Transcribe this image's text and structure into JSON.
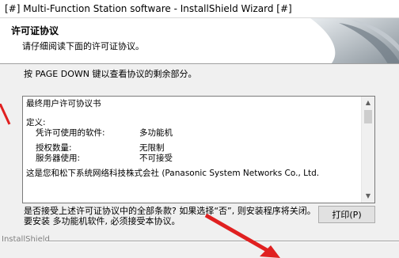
{
  "window": {
    "title": "[#] Multi-Function Station software - InstallShield Wizard [#]"
  },
  "header": {
    "title": "许可证协议",
    "subtitle": "请仔细阅读下面的许可证协议。"
  },
  "instruction": "按 PAGE DOWN 键以查看协议的剩余部分。",
  "license": {
    "heading": "最终用户许可协议书",
    "definition_label": "定义:",
    "rows": [
      {
        "key": "凭许可使用的软件:",
        "value": "多功能机"
      },
      {
        "key": "授权数量:",
        "value": "无限制"
      },
      {
        "key": "服务器使用:",
        "value": "不可接受"
      }
    ],
    "last_line": "这是您和松下系统网络科技株式会社 (Panasonic System Networks Co., Ltd."
  },
  "scrollbar": {
    "up_icon": "▲",
    "down_icon": "▼",
    "position": 0.0
  },
  "question": "是否接受上述许可证协议中的全部条款? 如果选择“否”, 则安装程序将关闭。要安装 多功能机软件, 必须接受本协议。",
  "buttons": {
    "print": "打印(P)"
  },
  "footer": {
    "brand": "InstallShield"
  },
  "colors": {
    "annotation_arrow": "#e02020"
  }
}
